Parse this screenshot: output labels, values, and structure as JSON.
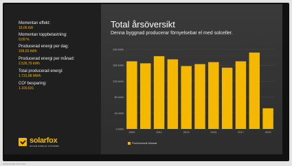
{
  "stats": [
    {
      "label": "Momentan effekt:",
      "value": "16,06 kW"
    },
    {
      "label": "Momentan toppbelastning:",
      "value": "9,09 %"
    },
    {
      "label": "Producerad energi per dag:",
      "value": "109,03 kWh"
    },
    {
      "label": "Producerad energi per månad:",
      "value": "2.526,79 kWh"
    },
    {
      "label": "Total producerad energi:",
      "value": "1.731,98 MWh"
    },
    {
      "label": "CO² besparing:",
      "value": "1.160,631"
    }
  ],
  "brand": {
    "name": "solarfox",
    "tagline": "SOLAR DISPLAY SYSTEMS"
  },
  "main": {
    "title": "Total årsöversikt",
    "subtitle": "Denna byggnad producerar förnyelsebar el med solceller."
  },
  "chart_data": {
    "type": "bar",
    "categories": [
      "2009",
      "2010",
      "2011",
      "2012",
      "2013",
      "2014",
      "2015",
      "2016",
      "2017",
      "2018",
      "2019"
    ],
    "series": [
      {
        "name": "Producerade kilowat",
        "values": [
          170,
          165,
          183,
          175,
          158,
          163,
          168,
          154,
          170,
          192,
          52
        ]
      }
    ],
    "x_tick_labels": [
      "2009",
      "2011",
      "2013",
      "2015",
      "2017",
      "2019"
    ],
    "y_tick_labels": [
      "0 kWh",
      "40 kWh",
      "80 kWh",
      "120 kWh",
      "160 kWh",
      "200 kWh"
    ],
    "y_ticks": [
      0,
      40,
      80,
      120,
      160,
      200
    ],
    "ylim": [
      0,
      200
    ],
    "grid": true,
    "legend": "bottom-left",
    "colors": {
      "bar": "#f5b800",
      "grid": "#4a4a4a",
      "axis_text": "#bbbbbb"
    }
  },
  "footer": "www.solar-fox.com"
}
